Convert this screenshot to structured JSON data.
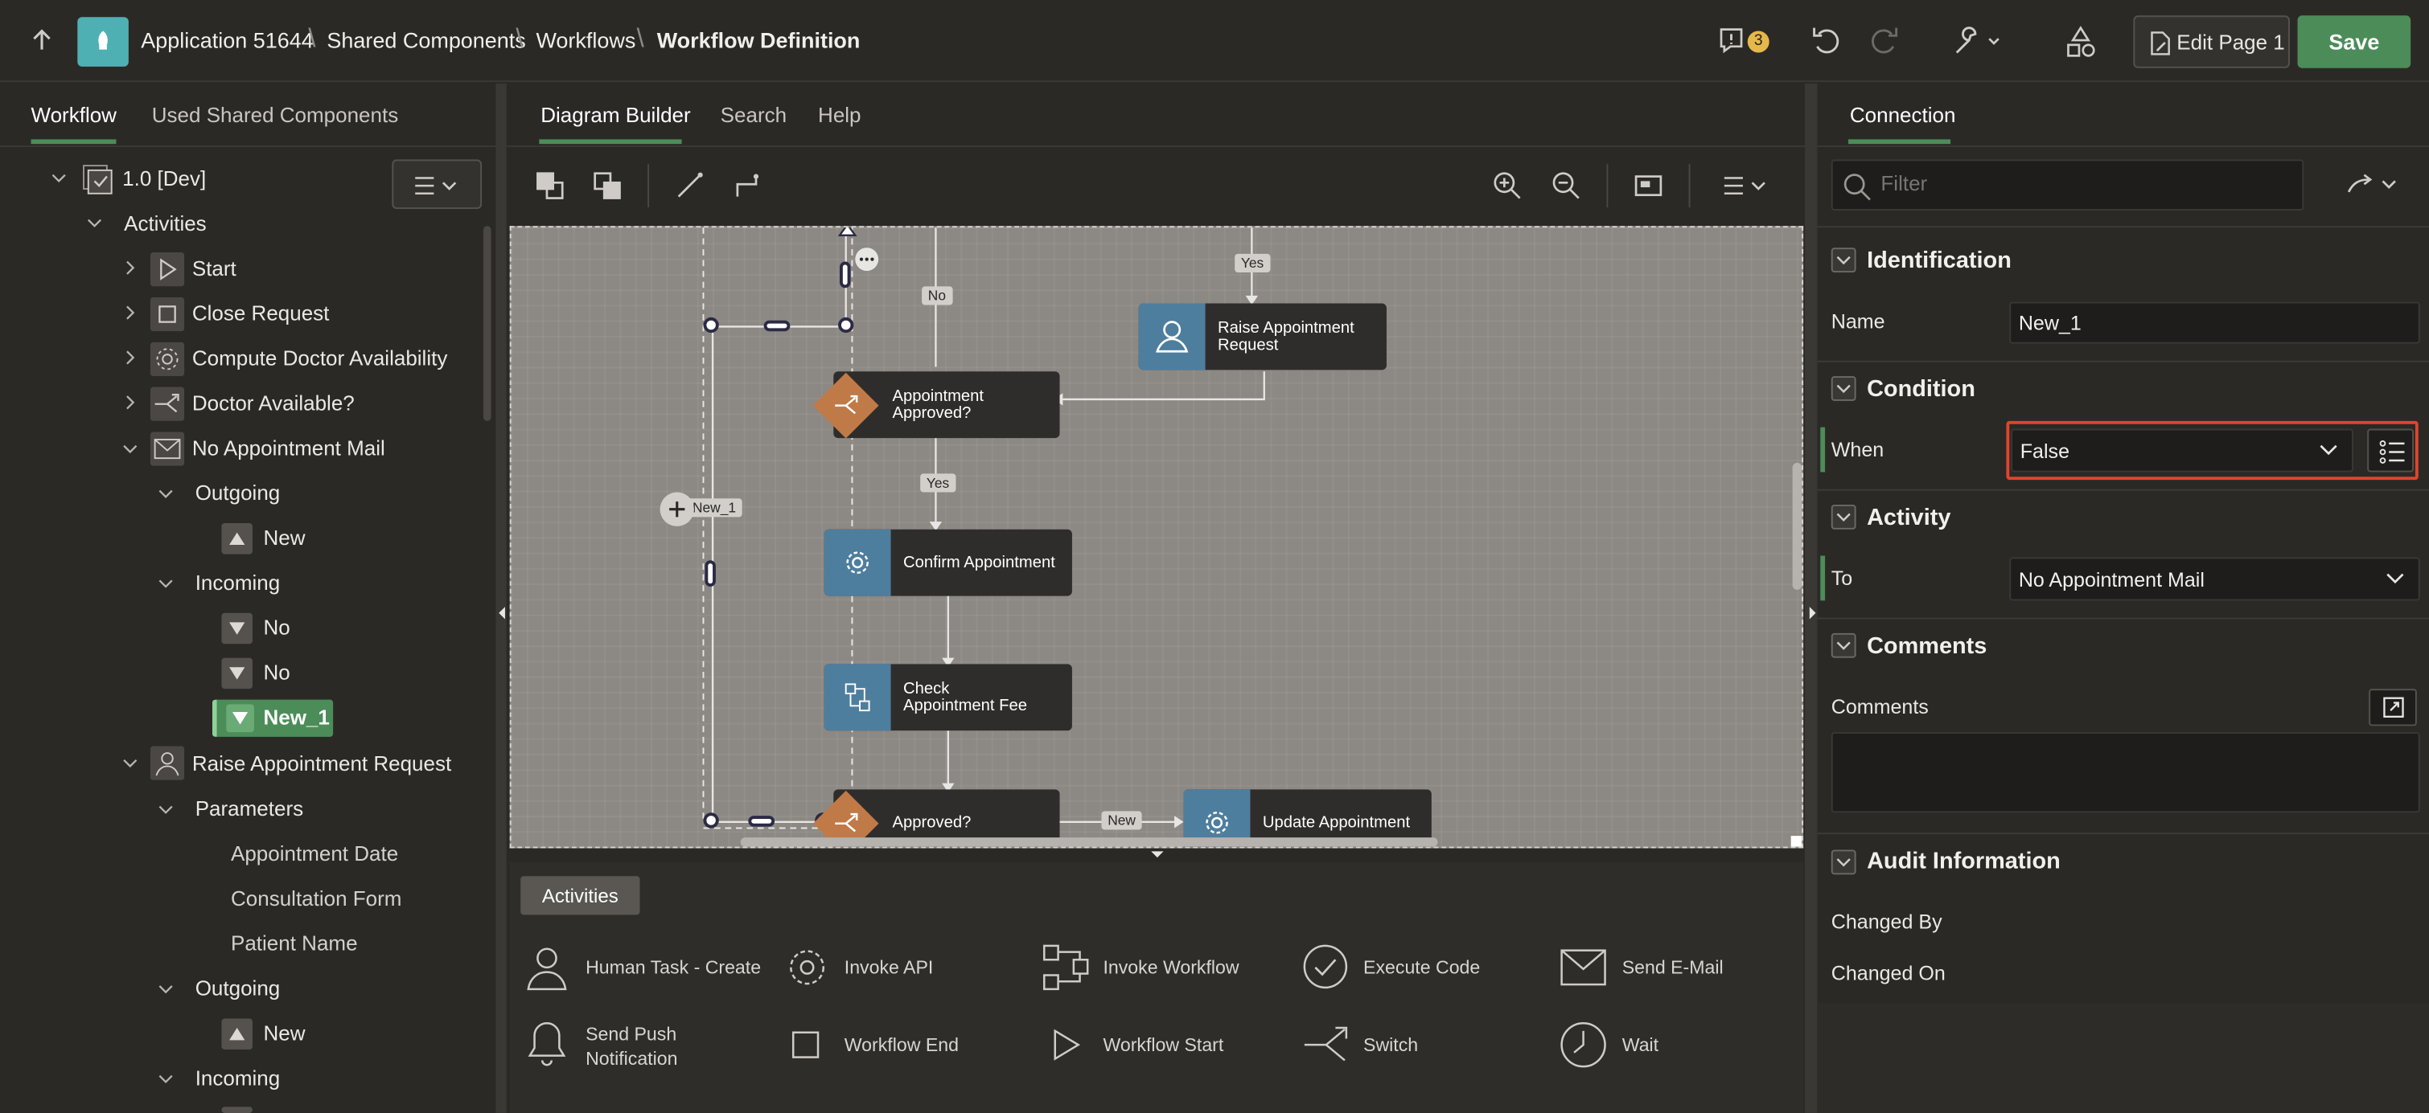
{
  "topbar": {
    "app": "Application 51644",
    "crumb1": "Shared Components",
    "crumb2": "Workflows",
    "crumb3": "Workflow Definition",
    "badge": "3",
    "edit_label": "Edit Page 1",
    "save_label": "Save"
  },
  "left": {
    "tab_workflow": "Workflow",
    "tab_used": "Used Shared Components",
    "tree": {
      "root": "1.0 [Dev]",
      "activities": "Activities",
      "start": "Start",
      "close": "Close Request",
      "compute": "Compute Doctor Availability",
      "doctor": "Doctor Available?",
      "nomail": "No Appointment Mail",
      "outgoing": "Outgoing",
      "new": "New",
      "incoming": "Incoming",
      "no": "No",
      "new1": "New_1",
      "raise": "Raise Appointment Request",
      "parameters": "Parameters",
      "p1": "Appointment Date",
      "p2": "Consultation Form",
      "p3": "Patient Name"
    }
  },
  "center": {
    "tab_diagram": "Diagram Builder",
    "tab_search": "Search",
    "tab_help": "Help",
    "nodes": {
      "raise": "Raise Appointment Request",
      "approved_q": "Appointment Approved?",
      "confirm": "Confirm Appointment",
      "check": "Check Appointment Fee",
      "approved": "Approved?",
      "update": "Update Appointment"
    },
    "labels": {
      "yes": "Yes",
      "no": "No",
      "new": "New",
      "new1": "New_1"
    },
    "palette_title": "Activities",
    "palette": {
      "human": "Human Task - Create",
      "api": "Invoke API",
      "workflow": "Invoke Workflow",
      "exec": "Execute Code",
      "email": "Send E-Mail",
      "push": "Send Push Notification",
      "end": "Workflow End",
      "start": "Workflow Start",
      "switch": "Switch",
      "wait": "Wait"
    }
  },
  "right": {
    "tab": "Connection",
    "filter_placeholder": "Filter",
    "sections": {
      "ident": "Identification",
      "cond": "Condition",
      "activity": "Activity",
      "comments": "Comments",
      "audit": "Audit Information"
    },
    "fields": {
      "name_label": "Name",
      "name_value": "New_1",
      "when_label": "When",
      "when_value": "False",
      "to_label": "To",
      "to_value": "No Appointment Mail",
      "comments_label": "Comments",
      "changed_by": "Changed By",
      "changed_on": "Changed On"
    }
  },
  "colors": {
    "accent_green": "#4c8c58",
    "highlight_red": "#e0442c",
    "node_blue": "#4e7e9e",
    "diamond_orange": "#c07a48"
  }
}
